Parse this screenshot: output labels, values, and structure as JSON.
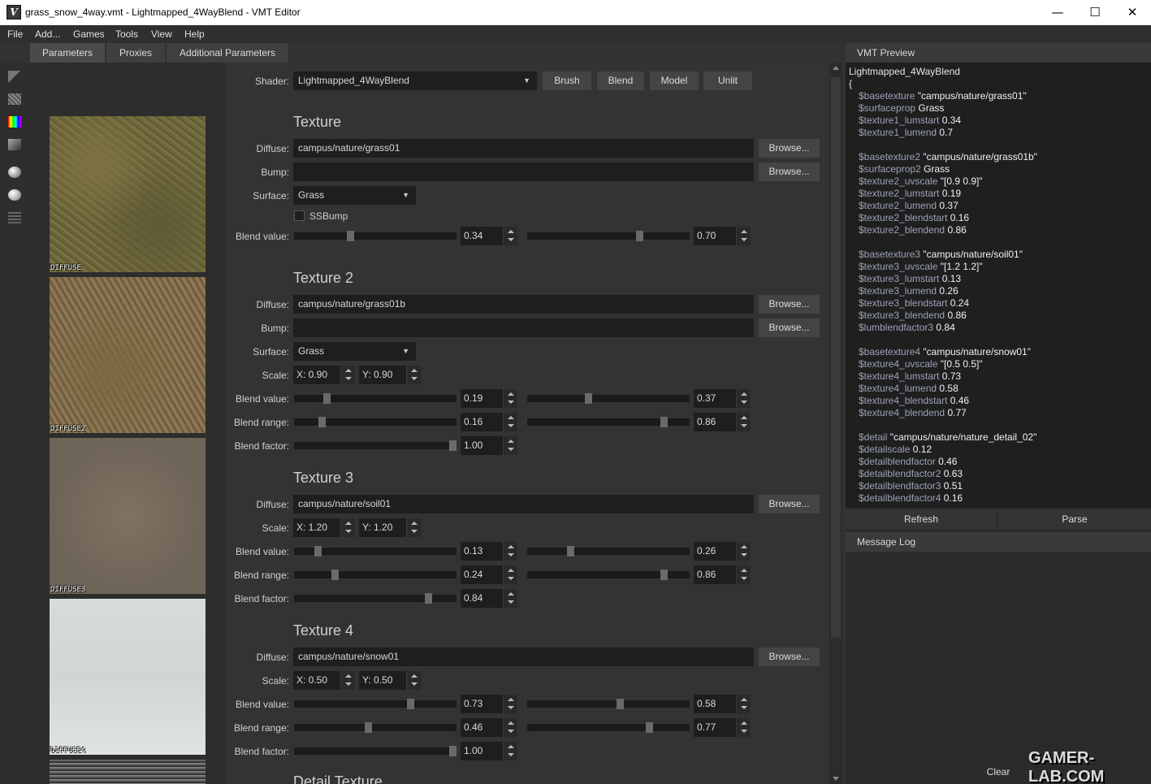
{
  "window": {
    "title": "grass_snow_4way.vmt - Lightmapped_4WayBlend - VMT Editor",
    "minimize": "—",
    "maximize": "☐",
    "close": "✕"
  },
  "menu": [
    "File",
    "Add...",
    "Games",
    "Tools",
    "View",
    "Help"
  ],
  "tabs": [
    "Parameters",
    "Proxies",
    "Additional Parameters"
  ],
  "thumbnails": [
    "DIFFUSE",
    "DIFFUSE2",
    "DIFFUSE3",
    "DIFFUSE4"
  ],
  "shader": {
    "label": "Shader:",
    "value": "Lightmapped_4WayBlend",
    "buttons": [
      "Brush",
      "Blend",
      "Model",
      "Unlit"
    ]
  },
  "labels": {
    "diffuse": "Diffuse:",
    "bump": "Bump:",
    "surface": "Surface:",
    "scale": "Scale:",
    "blend_value": "Blend value:",
    "blend_range": "Blend range:",
    "blend_factor": "Blend factor:",
    "browse": "Browse...",
    "ssbump": "SSBump"
  },
  "texture1": {
    "title": "Texture",
    "diffuse": "campus/nature/grass01",
    "bump": "",
    "surface": "Grass",
    "blend_value_a": "0.34",
    "blend_value_b": "0.70"
  },
  "texture2": {
    "title": "Texture 2",
    "diffuse": "campus/nature/grass01b",
    "bump": "",
    "surface": "Grass",
    "scale_x": "X: 0.90",
    "scale_y": "Y: 0.90",
    "blend_value_a": "0.19",
    "blend_value_b": "0.37",
    "blend_range_a": "0.16",
    "blend_range_b": "0.86",
    "blend_factor": "1.00"
  },
  "texture3": {
    "title": "Texture 3",
    "diffuse": "campus/nature/soil01",
    "scale_x": "X: 1.20",
    "scale_y": "Y: 1.20",
    "blend_value_a": "0.13",
    "blend_value_b": "0.26",
    "blend_range_a": "0.24",
    "blend_range_b": "0.86",
    "blend_factor": "0.84"
  },
  "texture4": {
    "title": "Texture 4",
    "diffuse": "campus/nature/snow01",
    "scale_x": "X: 0.50",
    "scale_y": "Y: 0.50",
    "blend_value_a": "0.73",
    "blend_value_b": "0.58",
    "blend_range_a": "0.46",
    "blend_range_b": "0.77",
    "blend_factor": "1.00"
  },
  "detail_title": "Detail Texture",
  "vmt_preview": {
    "header": "VMT Preview",
    "lines": [
      [
        "",
        "Lightmapped_4WayBlend"
      ],
      [
        "",
        "{"
      ],
      [
        "$basetexture ",
        "\"campus/nature/grass01\""
      ],
      [
        "$surfaceprop ",
        "Grass"
      ],
      [
        "$texture1_lumstart ",
        "0.34"
      ],
      [
        "$texture1_lumend ",
        "0.7"
      ],
      [
        "",
        ""
      ],
      [
        "$basetexture2 ",
        "\"campus/nature/grass01b\""
      ],
      [
        "$surfaceprop2 ",
        "Grass"
      ],
      [
        "$texture2_uvscale ",
        "\"[0.9 0.9]\""
      ],
      [
        "$texture2_lumstart ",
        "0.19"
      ],
      [
        "$texture2_lumend ",
        "0.37"
      ],
      [
        "$texture2_blendstart ",
        "0.16"
      ],
      [
        "$texture2_blendend ",
        "0.86"
      ],
      [
        "",
        ""
      ],
      [
        "$basetexture3 ",
        "\"campus/nature/soil01\""
      ],
      [
        "$texture3_uvscale ",
        "\"[1.2 1.2]\""
      ],
      [
        "$texture3_lumstart ",
        "0.13"
      ],
      [
        "$texture3_lumend ",
        "0.26"
      ],
      [
        "$texture3_blendstart ",
        "0.24"
      ],
      [
        "$texture3_blendend ",
        "0.86"
      ],
      [
        "$lumblendfactor3 ",
        "0.84"
      ],
      [
        "",
        ""
      ],
      [
        "$basetexture4 ",
        "\"campus/nature/snow01\""
      ],
      [
        "$texture4_uvscale ",
        "\"[0.5 0.5]\""
      ],
      [
        "$texture4_lumstart ",
        "0.73"
      ],
      [
        "$texture4_lumend ",
        "0.58"
      ],
      [
        "$texture4_blendstart ",
        "0.46"
      ],
      [
        "$texture4_blendend ",
        "0.77"
      ],
      [
        "",
        ""
      ],
      [
        "$detail ",
        "\"campus/nature/nature_detail_02\""
      ],
      [
        "$detailscale ",
        "0.12"
      ],
      [
        "$detailblendfactor ",
        "0.46"
      ],
      [
        "$detailblendfactor2 ",
        "0.63"
      ],
      [
        "$detailblendfactor3 ",
        "0.51"
      ],
      [
        "$detailblendfactor4 ",
        "0.16"
      ]
    ],
    "refresh": "Refresh",
    "parse": "Parse"
  },
  "message_log": {
    "header": "Message Log",
    "clear": "Clear"
  },
  "watermark": "GAMER-LAB.COM"
}
